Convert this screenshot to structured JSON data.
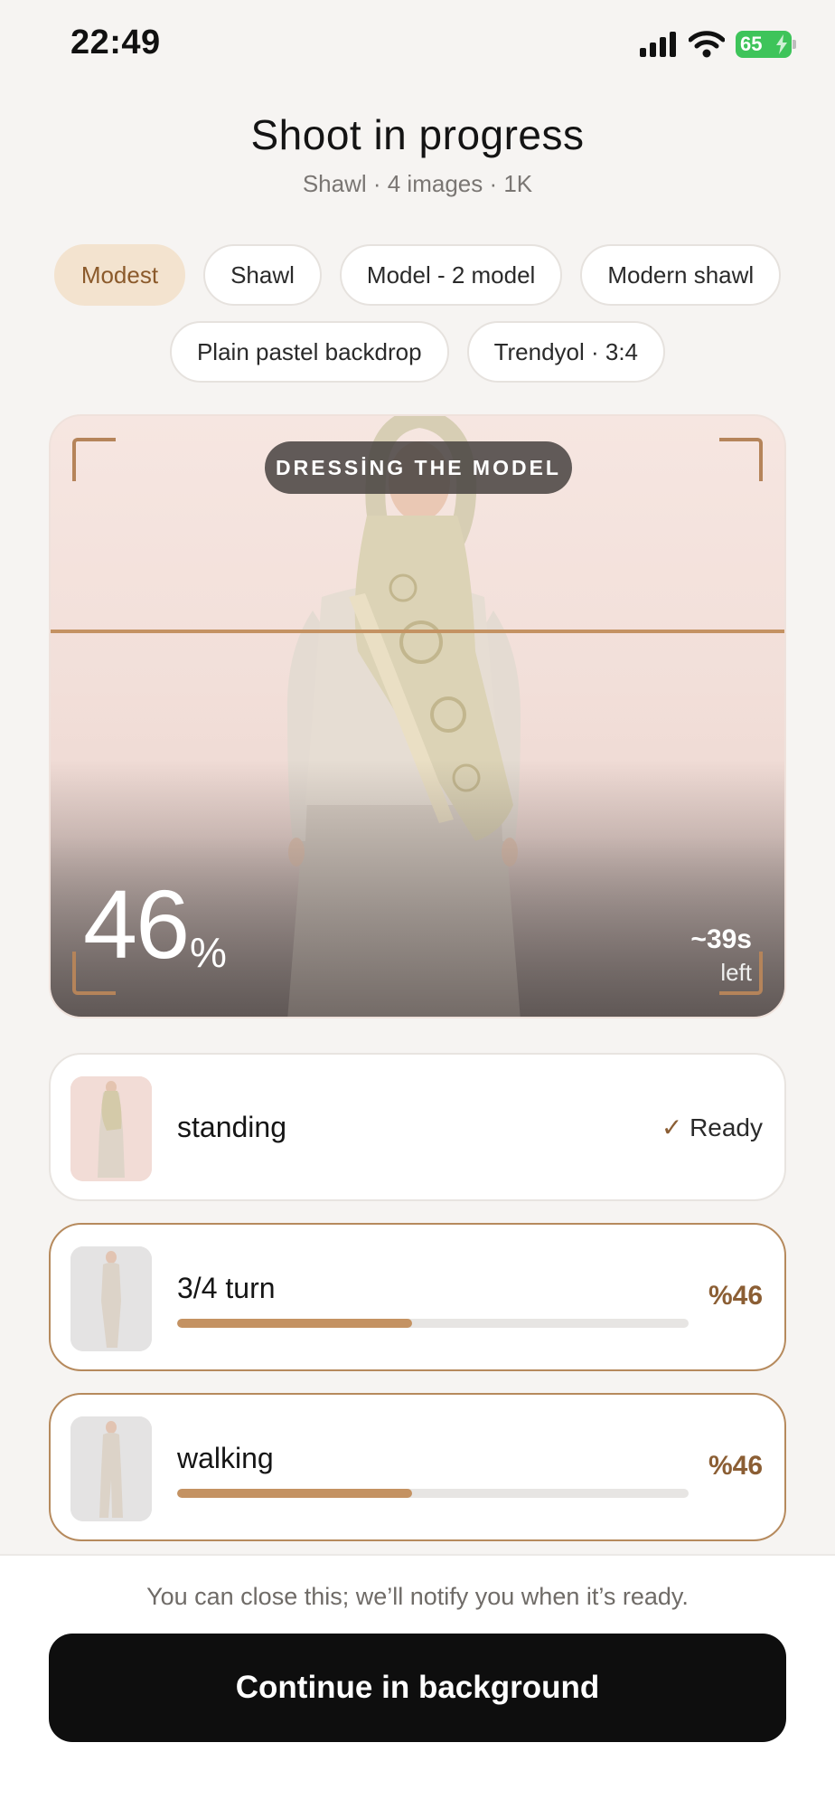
{
  "status_bar": {
    "time": "22:49",
    "battery": "65",
    "icons": [
      "signal-icon",
      "wifi-icon",
      "battery-charging-icon"
    ]
  },
  "header": {
    "title": "Shoot in progress",
    "subtitle": "Shawl · 4 images · 1K"
  },
  "chips": {
    "row1": [
      "Modest",
      "Shawl",
      "Model - 2 model",
      "Modern shawl"
    ],
    "row2": [
      "Plain pastel backdrop",
      "Trendyol · 3:4"
    ],
    "active_index": 0
  },
  "preview": {
    "stage": "DRESSİNG THE MODEL",
    "percent": "46",
    "percent_symbol": "%",
    "time_left": "~39s",
    "time_left_label": "left",
    "progress_fraction": 0.46
  },
  "poses": [
    {
      "name": "standing",
      "status": "Ready",
      "status_icon": "checkmark-icon",
      "state": "ready"
    },
    {
      "name": "3/4 turn",
      "percent_label": "%46",
      "progress": 0.46,
      "state": "active"
    },
    {
      "name": "walking",
      "percent_label": "%46",
      "progress": 0.46,
      "state": "active"
    }
  ],
  "footer": {
    "notice": "You can close this; we’ll notify you when it’s ready.",
    "button_label": "Continue in background"
  },
  "colors": {
    "accent": "#c49262",
    "accent_text": "#8b5e34",
    "active_chip_bg": "#f3e3cf",
    "button_bg": "#0e0e0e",
    "background": "#f6f4f2"
  }
}
